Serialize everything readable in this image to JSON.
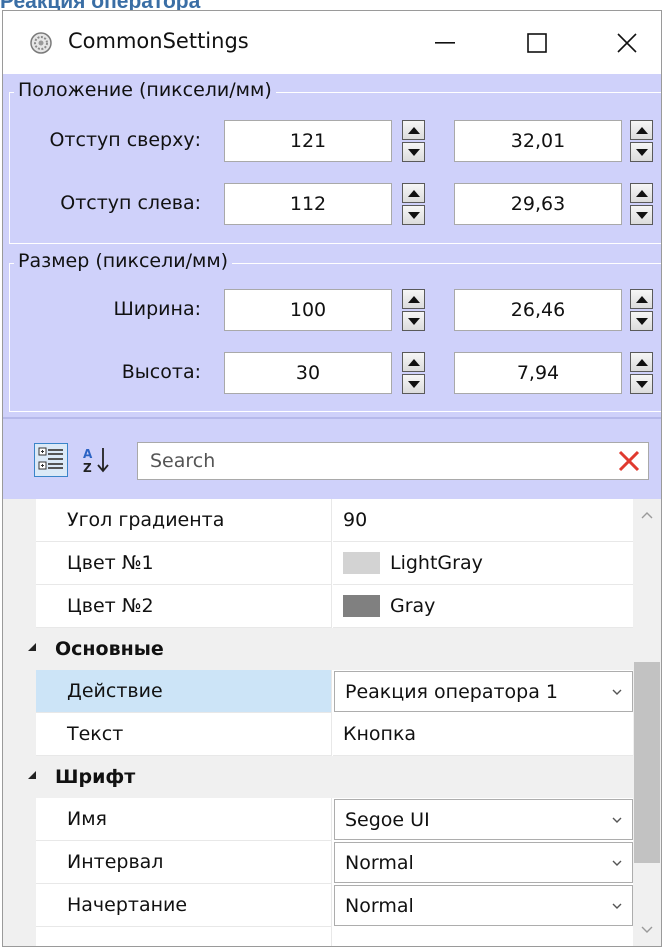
{
  "page_heading": "Реакция оператора",
  "window": {
    "title": "CommonSettings",
    "icon": "gear-icon"
  },
  "position_group": {
    "legend": "Положение (пиксели/мм)",
    "rows": [
      {
        "label": "Отступ сверху:",
        "pixels": "121",
        "mm": "32,01"
      },
      {
        "label": "Отступ слева:",
        "pixels": "112",
        "mm": "29,63"
      }
    ]
  },
  "size_group": {
    "legend": "Размер (пиксели/мм)",
    "rows": [
      {
        "label": "Ширина:",
        "pixels": "100",
        "mm": "26,46"
      },
      {
        "label": "Высота:",
        "pixels": "30",
        "mm": "7,94"
      }
    ]
  },
  "toolbar": {
    "search_placeholder": "Search",
    "categorized_icon": "categorized-icon",
    "sort_icon": "sort-az-icon",
    "clear_icon": "clear-search-icon"
  },
  "properties": {
    "top_rows": [
      {
        "name": "Угол градиента",
        "value": "90"
      },
      {
        "name": "Цвет №1",
        "value": "LightGray",
        "swatch": "#d3d3d3"
      },
      {
        "name": "Цвет №2",
        "value": "Gray",
        "swatch": "#808080"
      }
    ],
    "categories": [
      {
        "label": "Основные",
        "rows": [
          {
            "name": "Действие",
            "value": "Реакция оператора 1",
            "combo": true,
            "selected": true
          },
          {
            "name": "Текст",
            "value": "Кнопка"
          }
        ]
      },
      {
        "label": "Шрифт",
        "rows": [
          {
            "name": "Имя",
            "value": "Segoe UI",
            "combo": true
          },
          {
            "name": "Интервал",
            "value": "Normal",
            "combo": true
          },
          {
            "name": "Начертание",
            "value": "Normal",
            "combo": true
          }
        ]
      }
    ]
  },
  "colors": {
    "settings_bg": "#cfd1fa",
    "selected_row": "#cce4f7",
    "clear_red": "#e03a2f"
  }
}
